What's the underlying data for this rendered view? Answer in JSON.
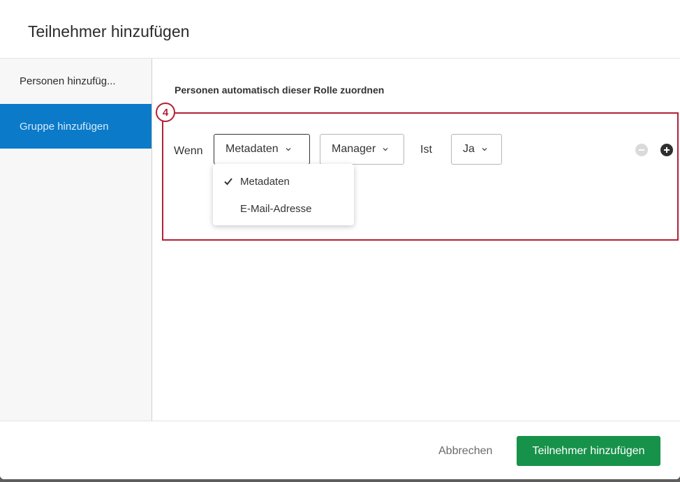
{
  "dialog": {
    "title": "Teilnehmer hinzufügen"
  },
  "sidebar": {
    "items": [
      {
        "label": "Personen hinzufüg..."
      },
      {
        "label": "Gruppe hinzufügen"
      }
    ],
    "active_color": "#0b7ac9"
  },
  "main": {
    "section_heading": "Personen automatisch dieser Rolle zuordnen",
    "step_badge": "4",
    "highlight_color": "#b22034",
    "condition": {
      "if_label": "Wenn",
      "field_select": "Metadaten",
      "value_select": "Manager",
      "operator_label": "Ist",
      "answer_select": "Ja"
    },
    "dropdown": {
      "options": [
        {
          "label": "Metadaten",
          "selected": true
        },
        {
          "label": "E-Mail-Adresse",
          "selected": false
        }
      ]
    },
    "icons": {
      "remove": "minus-circle-icon",
      "add": "plus-circle-icon",
      "check": "checkmark-icon",
      "chevron": "chevron-down-icon"
    }
  },
  "footer": {
    "cancel_label": "Abbrechen",
    "submit_label": "Teilnehmer hinzufügen",
    "submit_color": "#17924a"
  }
}
